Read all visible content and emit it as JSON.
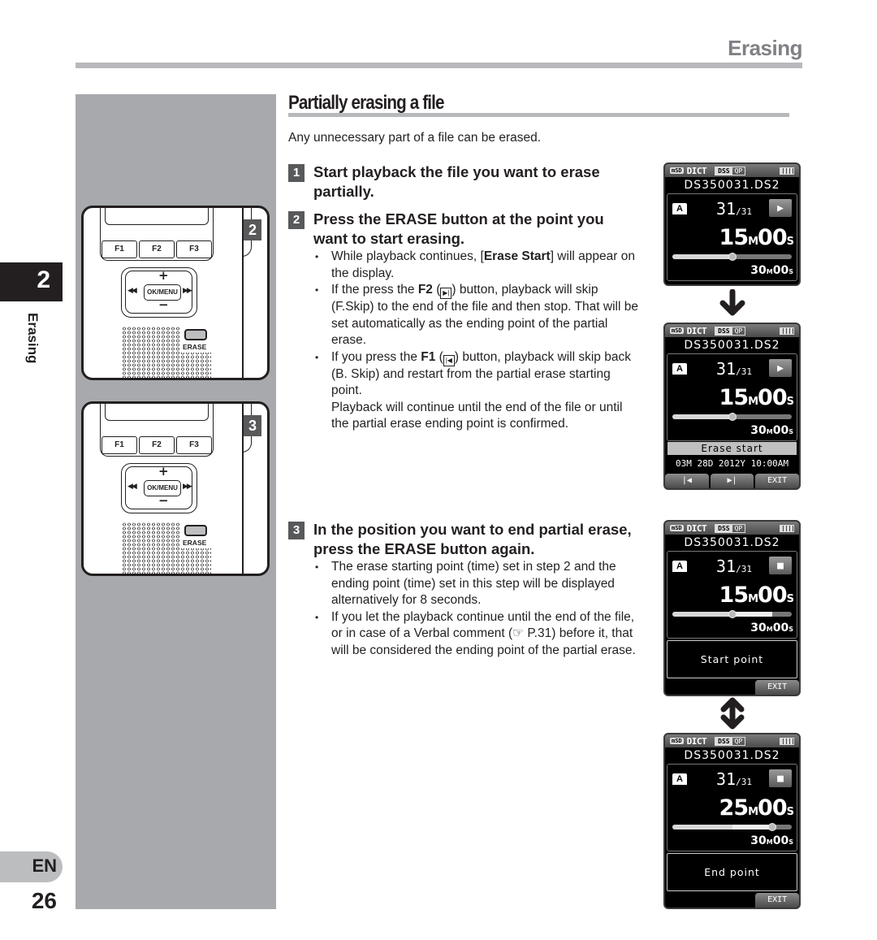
{
  "header": {
    "title": "Erasing"
  },
  "chapter_tab": {
    "number": "2",
    "label": "Erasing"
  },
  "footer": {
    "language": "EN",
    "page_number": "26"
  },
  "illustrations": [
    {
      "step_badge": "2",
      "fkeys": [
        "F1",
        "F2",
        "F3"
      ],
      "dpad": {
        "plus": "+",
        "minus": "−",
        "prev": "◀◀",
        "next": "▶▶",
        "center": "OK/MENU"
      },
      "erase_label": "ERASE"
    },
    {
      "step_badge": "3",
      "fkeys": [
        "F1",
        "F2",
        "F3"
      ],
      "dpad": {
        "plus": "+",
        "minus": "−",
        "prev": "◀◀",
        "next": "▶▶",
        "center": "OK/MENU"
      },
      "erase_label": "ERASE"
    }
  ],
  "section": {
    "title": "Partially erasing a file",
    "intro": "Any unnecessary part of a file can be erased."
  },
  "steps": [
    {
      "number": "1",
      "heading": "Start playback the file you want to erase partially.",
      "bullets": []
    },
    {
      "number": "2",
      "heading_pre": "Press the ",
      "heading_bold": "ERASE",
      "heading_post": " button at the point you want to start erasing.",
      "bullets": [
        {
          "pre": "While playback continues, [",
          "bold": "Erase Start",
          "post": "] will appear on the display."
        },
        {
          "pre": "If the press the ",
          "bold": "F2",
          "icon": "skip-forward-icon",
          "icon_glyph": "▶|",
          "post": " button, playback will skip (F.Skip) to the end of the file and then stop. That will be set automatically as the ending point of the partial erase."
        },
        {
          "pre": "If you press the ",
          "bold": "F1",
          "icon": "skip-back-icon",
          "icon_glyph": "|◀",
          "post": " button, playback will skip back (B. Skip) and restart from the partial erase starting point."
        },
        {
          "continuation": "Playback will continue until the end of the file or until the partial erase ending point is confirmed."
        }
      ]
    },
    {
      "number": "3",
      "heading_pre": "In the position you want to end partial erase, press the ",
      "heading_bold": "ERASE",
      "heading_post": " button again.",
      "bullets": [
        {
          "text": "The erase starting point (time) set in step 2 and the ending point (time) set in this step will be displayed alternatively for 8 seconds."
        },
        {
          "text": "If you let the playback continue until the end of the file, or in case of a Verbal comment (☞ P.31) before it, that will be considered the ending point of the partial erase."
        }
      ]
    }
  ],
  "screens": [
    {
      "status_bar": {
        "card": "mSD",
        "mode": "DICT",
        "format": "DSS",
        "quality": "QP"
      },
      "filename": "DS350031.DS2",
      "folder": "A",
      "file_index": "31",
      "file_total": "/31",
      "state_icon": "▶",
      "elapsed": {
        "min": "15",
        "m": "M",
        "sec": "00",
        "s": "S"
      },
      "total": {
        "min": "30",
        "m": "M",
        "sec": "00",
        "s": "S"
      },
      "progress": 0.5
    },
    {
      "status_bar": {
        "card": "mSD",
        "mode": "DICT",
        "format": "DSS",
        "quality": "QP"
      },
      "filename": "DS350031.DS2",
      "folder": "A",
      "file_index": "31",
      "file_total": "/31",
      "state_icon": "▶",
      "elapsed": {
        "min": "15",
        "m": "M",
        "sec": "00",
        "s": "S"
      },
      "total": {
        "min": "30",
        "m": "M",
        "sec": "00",
        "s": "S"
      },
      "progress": 0.5,
      "status_text": "Erase start",
      "date": "03M 28D 2012Y 10:00AM",
      "softkeys": [
        "|◀",
        "▶|",
        "EXIT"
      ]
    },
    {
      "status_bar": {
        "card": "mSD",
        "mode": "DICT",
        "format": "DSS",
        "quality": "QP"
      },
      "filename": "DS350031.DS2",
      "folder": "A",
      "file_index": "31",
      "file_total": "/31",
      "state_icon": "■",
      "elapsed": {
        "min": "15",
        "m": "M",
        "sec": "00",
        "s": "S"
      },
      "total": {
        "min": "30",
        "m": "M",
        "sec": "00",
        "s": "S"
      },
      "progress": 0.5,
      "segment": [
        0.5,
        0.84
      ],
      "message": "Start point",
      "softkeys": [
        "",
        "",
        "EXIT"
      ]
    },
    {
      "status_bar": {
        "card": "mSD",
        "mode": "DICT",
        "format": "DSS",
        "quality": "QP"
      },
      "filename": "DS350031.DS2",
      "folder": "A",
      "file_index": "31",
      "file_total": "/31",
      "state_icon": "■",
      "elapsed": {
        "min": "25",
        "m": "M",
        "sec": "00",
        "s": "S"
      },
      "total": {
        "min": "30",
        "m": "M",
        "sec": "00",
        "s": "S"
      },
      "progress": 0.84,
      "segment": [
        0.5,
        0.84
      ],
      "message": "End point",
      "softkeys": [
        "",
        "",
        "EXIT"
      ]
    }
  ],
  "arrows": {
    "down": "🡇",
    "updown": "⇕"
  }
}
